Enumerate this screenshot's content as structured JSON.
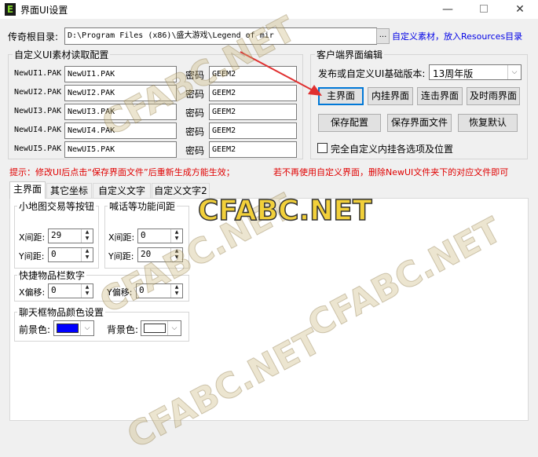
{
  "window": {
    "title": "界面UI设置",
    "app_icon_glyph": "E",
    "minimize_icon": "minimize-icon",
    "maximize_icon": "maximize-icon",
    "close_icon": "close-icon"
  },
  "root_dir": {
    "label": "传奇根目录:",
    "value": "D:\\Program Files (x86)\\盛大游戏\\Legend of mir",
    "browse_label": "...",
    "link_label": "自定义素材，放入Resources目录"
  },
  "ui_group": {
    "title": "自定义UI素材读取配置",
    "rows": [
      {
        "label": "NewUI1.PAK",
        "value": "NewUI1.PAK",
        "pwd_label": "密码",
        "pwd": "GEEM2"
      },
      {
        "label": "NewUI2.PAK",
        "value": "NewUI2.PAK",
        "pwd_label": "密码",
        "pwd": "GEEM2"
      },
      {
        "label": "NewUI3.PAK",
        "value": "NewUI3.PAK",
        "pwd_label": "密码",
        "pwd": "GEEM2"
      },
      {
        "label": "NewUI4.PAK",
        "value": "NewUI4.PAK",
        "pwd_label": "密码",
        "pwd": "GEEM2"
      },
      {
        "label": "NewUI5.PAK",
        "value": "NewUI5.PAK",
        "pwd_label": "密码",
        "pwd": "GEEM2"
      }
    ]
  },
  "client_group": {
    "title": "客户端界面编辑",
    "version_label": "发布或自定义UI基础版本:",
    "version_value": "13周年版",
    "buttons": {
      "main_ui": "主界面",
      "internal_hook": "内挂界面",
      "combo_ui": "连击界面",
      "timely_rain": "及时雨界面",
      "save_config": "保存配置",
      "save_ui_file": "保存界面文件",
      "restore_default": "恢复默认"
    },
    "full_custom_label": "完全自定义内挂各选项及位置"
  },
  "tips": {
    "left": "提示：修改UI后点击“保存界面文件”后重新生成方能生效；",
    "right": "若不再使用自定义界面，删除NewUI文件夹下的对应文件即可"
  },
  "tabs": [
    "主界面",
    "其它坐标",
    "自定义文字",
    "自定义文字2"
  ],
  "minimap_group": {
    "title": "小地图交易等按钮",
    "x_label": "X间距:",
    "x_value": "29",
    "y_label": "Y间距:",
    "y_value": "0"
  },
  "chat_group": {
    "title": "喊话等功能间距",
    "x_label": "X间距:",
    "x_value": "0",
    "y_label": "Y间距:",
    "y_value": "20"
  },
  "hotbar_group": {
    "title": "快捷物品栏数字",
    "x_label": "X偏移:",
    "x_value": "0",
    "y_label": "Y偏移:",
    "y_value": "0"
  },
  "chatcolor_group": {
    "title": "聊天框物品颜色设置",
    "fg_label": "前景色:",
    "fg_color": "#0000ff",
    "bg_label": "背景色:",
    "bg_color": "#ffffff"
  },
  "watermarks": {
    "main": "CFABC.NET",
    "faint": "CFABC.NET"
  },
  "colors": {
    "tip_red": "#e00000",
    "link_blue": "#0000e6",
    "focus_blue": "#0078d7",
    "arrow_red": "#e03030"
  }
}
